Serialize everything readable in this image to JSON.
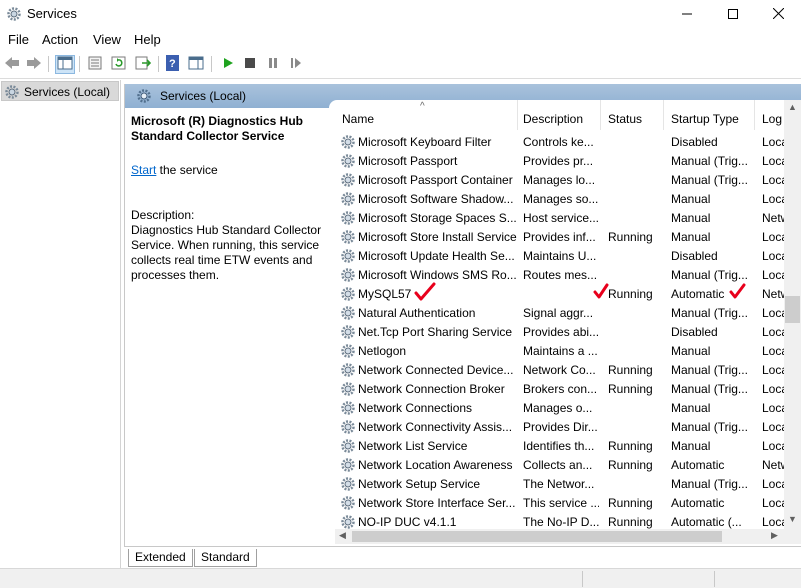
{
  "window": {
    "title": "Services",
    "minimize_icon": "minimize-icon",
    "maximize_icon": "maximize-icon",
    "close_icon": "close-icon"
  },
  "menu": [
    "File",
    "Action",
    "View",
    "Help"
  ],
  "toolbar": {
    "icons": [
      "back-arrow-icon",
      "forward-arrow-icon",
      "show-hide-tree-icon",
      "properties-icon",
      "refresh-icon",
      "export-list-icon",
      "help-icon",
      "show-action-pane-icon",
      "start-service-icon",
      "stop-service-icon",
      "pause-service-icon",
      "restart-service-icon"
    ]
  },
  "tree": {
    "selected_label": "Services (Local)"
  },
  "main": {
    "header_label": "Services (Local)",
    "selected_service": "Microsoft (R) Diagnostics Hub Standard Collector Service",
    "start_link": "Start",
    "start_suffix": " the service",
    "description_label": "Description:",
    "description_text": "Diagnostics Hub Standard Collector Service. When running, this service collects real time ETW events and processes them."
  },
  "columns": [
    {
      "label": "Name"
    },
    {
      "label": "Description"
    },
    {
      "label": "Status"
    },
    {
      "label": "Startup Type"
    },
    {
      "label": "Log"
    }
  ],
  "sort_indicator": "^",
  "rows": [
    {
      "name": "Microsoft Keyboard Filter",
      "description": "Controls ke...",
      "status": "",
      "startup": "Disabled",
      "log": "Loca"
    },
    {
      "name": "Microsoft Passport",
      "description": "Provides pr...",
      "status": "",
      "startup": "Manual (Trig...",
      "log": "Loca"
    },
    {
      "name": "Microsoft Passport Container",
      "description": "Manages lo...",
      "status": "",
      "startup": "Manual (Trig...",
      "log": "Loca"
    },
    {
      "name": "Microsoft Software Shadow...",
      "description": "Manages so...",
      "status": "",
      "startup": "Manual",
      "log": "Loca"
    },
    {
      "name": "Microsoft Storage Spaces S...",
      "description": "Host service...",
      "status": "",
      "startup": "Manual",
      "log": "Netw"
    },
    {
      "name": "Microsoft Store Install Service",
      "description": "Provides inf...",
      "status": "Running",
      "startup": "Manual",
      "log": "Loca"
    },
    {
      "name": "Microsoft Update Health Se...",
      "description": "Maintains U...",
      "status": "",
      "startup": "Disabled",
      "log": "Loca"
    },
    {
      "name": "Microsoft Windows SMS Ro...",
      "description": "Routes mes...",
      "status": "",
      "startup": "Manual (Trig...",
      "log": "Loca"
    },
    {
      "name": "MySQL57",
      "description": "",
      "status": "Running",
      "startup": "Automatic",
      "log": "Netw"
    },
    {
      "name": "Natural Authentication",
      "description": "Signal aggr...",
      "status": "",
      "startup": "Manual (Trig...",
      "log": "Loca"
    },
    {
      "name": "Net.Tcp Port Sharing Service",
      "description": "Provides abi...",
      "status": "",
      "startup": "Disabled",
      "log": "Loca"
    },
    {
      "name": "Netlogon",
      "description": "Maintains a ...",
      "status": "",
      "startup": "Manual",
      "log": "Loca"
    },
    {
      "name": "Network Connected Device...",
      "description": "Network Co...",
      "status": "Running",
      "startup": "Manual (Trig...",
      "log": "Loca"
    },
    {
      "name": "Network Connection Broker",
      "description": "Brokers con...",
      "status": "Running",
      "startup": "Manual (Trig...",
      "log": "Loca"
    },
    {
      "name": "Network Connections",
      "description": "Manages o...",
      "status": "",
      "startup": "Manual",
      "log": "Loca"
    },
    {
      "name": "Network Connectivity Assis...",
      "description": "Provides Dir...",
      "status": "",
      "startup": "Manual (Trig...",
      "log": "Loca"
    },
    {
      "name": "Network List Service",
      "description": "Identifies th...",
      "status": "Running",
      "startup": "Manual",
      "log": "Loca"
    },
    {
      "name": "Network Location Awareness",
      "description": "Collects an...",
      "status": "Running",
      "startup": "Automatic",
      "log": "Netw"
    },
    {
      "name": "Network Setup Service",
      "description": "The Networ...",
      "status": "",
      "startup": "Manual (Trig...",
      "log": "Loca"
    },
    {
      "name": "Network Store Interface Ser...",
      "description": "This service ...",
      "status": "Running",
      "startup": "Automatic",
      "log": "Loca"
    },
    {
      "name": "NO-IP DUC v4.1.1",
      "description": "The No-IP D...",
      "status": "Running",
      "startup": "Automatic (...",
      "log": "Loca"
    }
  ],
  "annotations": {
    "check_color": "#e8001c",
    "check_icon": "red-checkmark-icon"
  },
  "tabs": [
    "Extended",
    "Standard"
  ]
}
